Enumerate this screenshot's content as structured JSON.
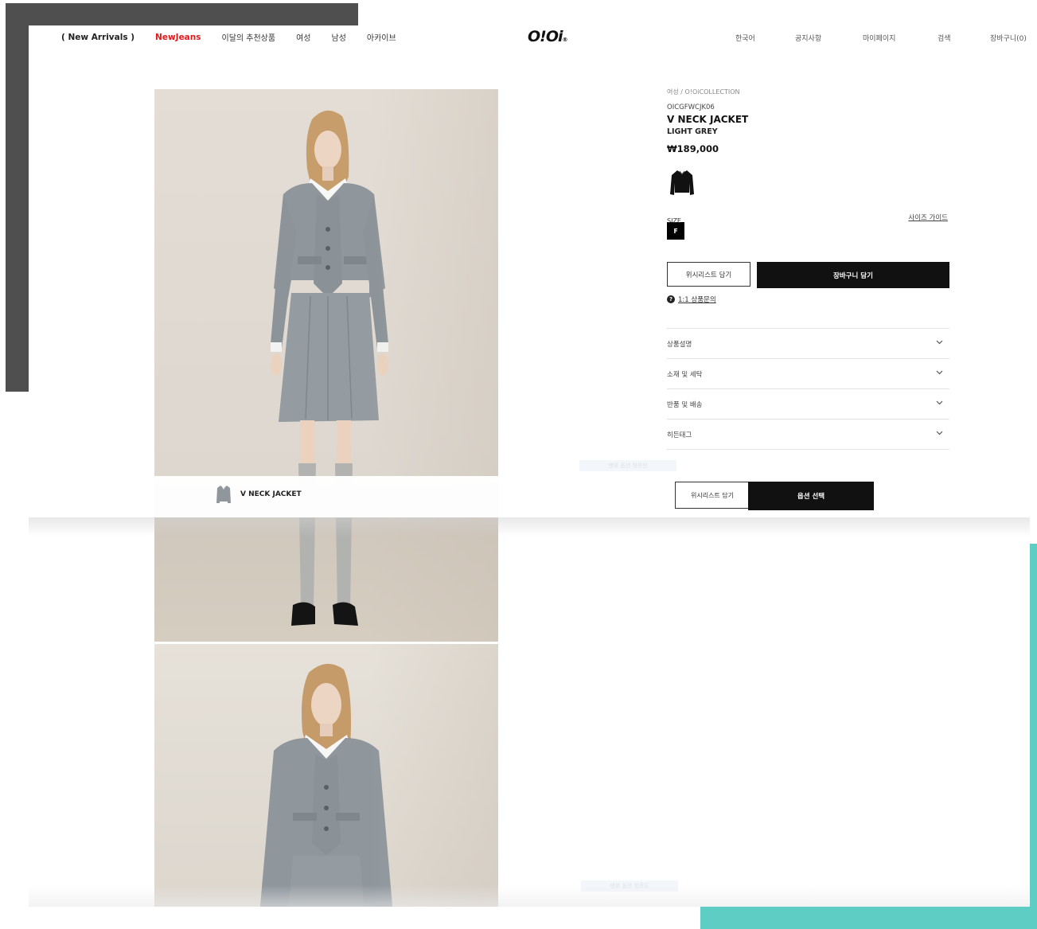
{
  "header": {
    "nav_left": [
      "( New Arrivals )",
      "NewJeans",
      "이달의 추천상품",
      "여성",
      "남성",
      "아카이브"
    ],
    "logo": "O!Oi",
    "logo_mark": "®",
    "nav_right": [
      "한국어",
      "공지사항",
      "마이페이지",
      "검색",
      "장바구니(0)"
    ]
  },
  "product": {
    "breadcrumb": "여성 / O!OiCOLLECTION",
    "code": "OICGFWCJK06",
    "name": "V NECK JACKET",
    "color": "LIGHT GREY",
    "price": "₩189,000",
    "swatch_icon": "jacket-swatch-icon",
    "size_label": "SIZE",
    "size_guide": "사이즈 가이드",
    "sizes": [
      "F"
    ],
    "wishlist_label": "위시리스트 담기",
    "cart_label": "장바구니 담기",
    "inquiry_label": "1:1 상품문의",
    "accordion": [
      "상품설명",
      "소재 및 세탁",
      "반품 및 배송",
      "히든태그"
    ]
  },
  "sticky_bar": {
    "name": "V NECK JACKET",
    "wishlist_label": "위시리스트 담기",
    "option_label": "옵션 선택"
  },
  "ghost_labels": [
    "맨위 옵션 항목만",
    "맨위 옵션 항목도"
  ],
  "colors": {
    "accent_red": "#e01b1b",
    "deco_grey": "#4f4f4f",
    "deco_teal": "#5ecdc4",
    "button_black": "#111111"
  }
}
